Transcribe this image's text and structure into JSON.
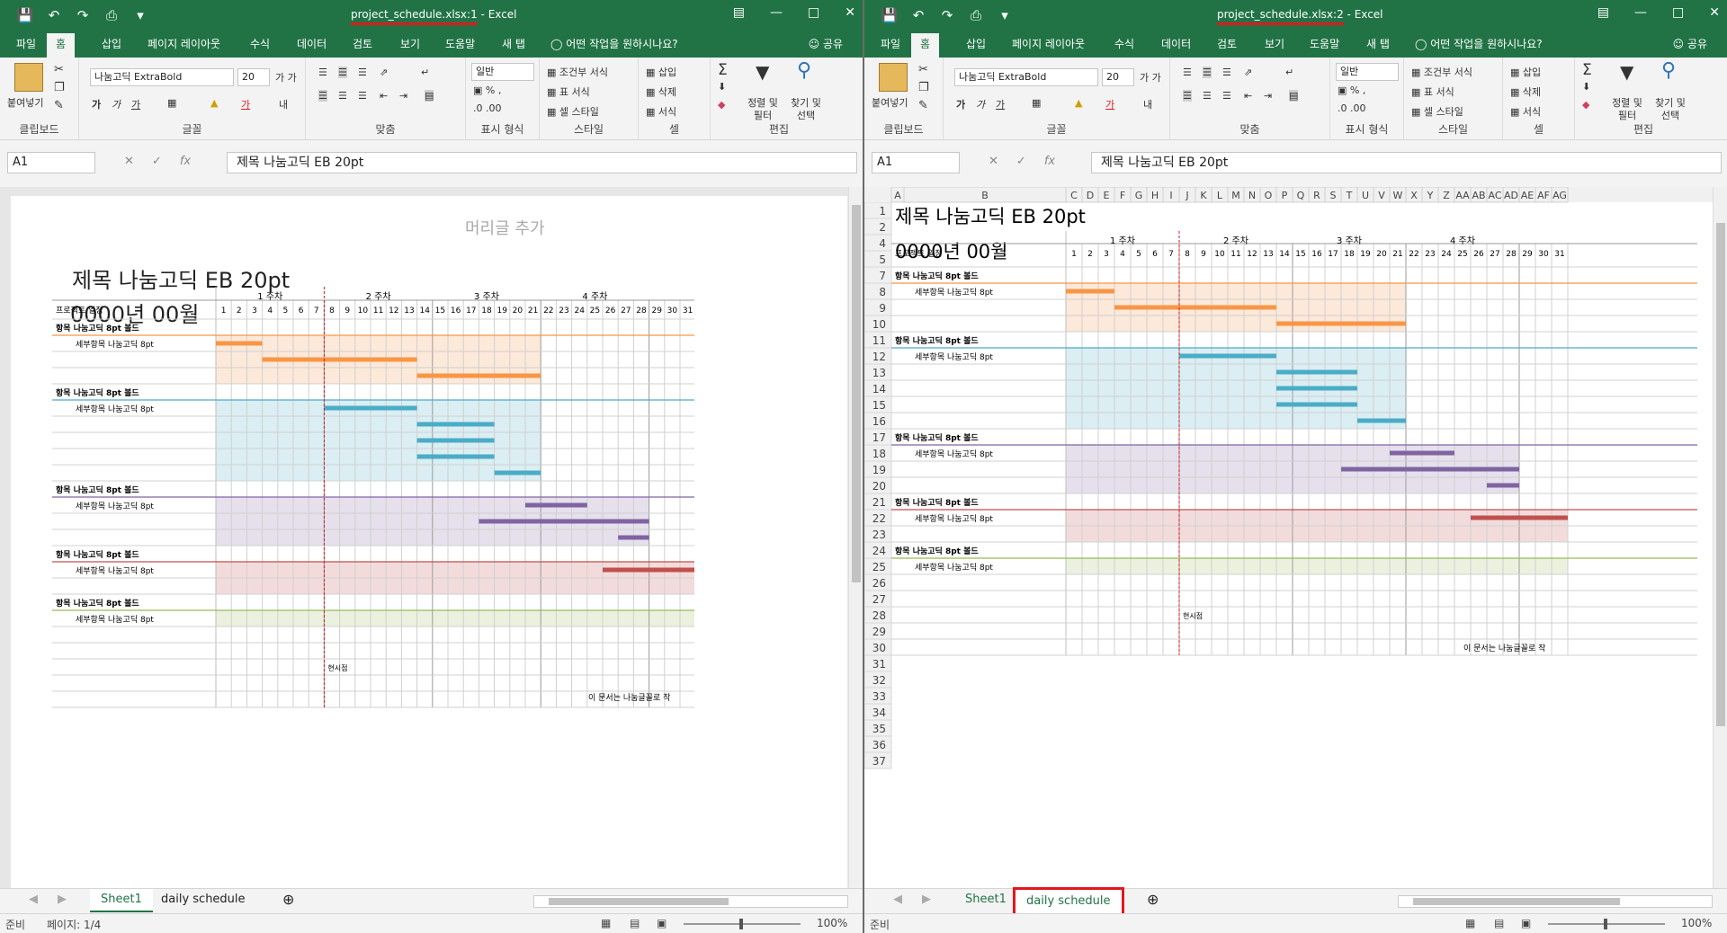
{
  "colors": {
    "excel_green": "#217346",
    "highlight_red": "#e0191e",
    "orange": "#f79646",
    "orange_band": "#fde9d9",
    "blue": "#4bacc6",
    "blue_band": "#daeef3",
    "purple": "#8064a2",
    "purple_band": "#e5e0ec",
    "red": "#c0504d",
    "red_band": "#f2dcdb",
    "green_band": "#ebf1de",
    "green_line": "#9bbb59"
  },
  "left": {
    "title_file": "project_schedule.xlsx:1",
    "title_sep": "-",
    "title_app": "Excel",
    "sheet_tabs": [
      "Sheet1",
      "daily schedule"
    ],
    "status_ready": "준비",
    "status_page": "페이지: 1/4",
    "zoom": "100%"
  },
  "right": {
    "title_file": "project_schedule.xlsx:2",
    "title_sep": "-",
    "title_app": "Excel",
    "sheet_tabs": [
      "Sheet1",
      "daily schedule"
    ],
    "status_ready": "준비",
    "zoom": "100%"
  },
  "ribbon_tabs": [
    "파일",
    "홈",
    "삽입",
    "페이지 레이아웃",
    "수식",
    "데이터",
    "검토",
    "보기",
    "도움말",
    "새 탭"
  ],
  "tell_me": "어떤 작업을 원하시나요?",
  "share": "공유",
  "ribbon": {
    "paste": "붙여넣기",
    "font_name": "나눔고딕 ExtraBold",
    "font_size": "20",
    "number_format": "일반",
    "cond_format": "조건부 서식",
    "table_format": "표 서식",
    "cell_style": "셀 스타일",
    "insert": "삽입",
    "delete": "삭제",
    "format": "서식",
    "sort_filter": "정렬 및 필터",
    "find_select": "찾기 및 선택",
    "groups": [
      "클립보드",
      "글꼴",
      "맞춤",
      "표시 형식",
      "스타일",
      "셀",
      "편집"
    ]
  },
  "name_box": "A1",
  "formula": "제목 나눔고딕 EB 20pt",
  "doc": {
    "header_placeholder": "머리글 추가",
    "title": "제목 나눔고딕 EB 20pt",
    "subtitle": "0000년 00월",
    "schedule_label": "프로젝트 일정",
    "weeks": [
      "1 주차",
      "2 주차",
      "3 주차",
      "4 주차"
    ],
    "days": [
      "1",
      "2",
      "3",
      "4",
      "5",
      "6",
      "7",
      "8",
      "9",
      "10",
      "11",
      "12",
      "13",
      "14",
      "15",
      "16",
      "17",
      "18",
      "19",
      "20",
      "21",
      "22",
      "23",
      "24",
      "25",
      "26",
      "27",
      "28",
      "29",
      "30",
      "31"
    ],
    "section": "항목 나눔고딕 8pt 볼드",
    "sub": "세부항목 나눔고딕 8pt",
    "today": "현시점",
    "footer": "이 문서는 나눔글꼴로 작"
  },
  "right_cols": [
    "A",
    "B",
    "C",
    "D",
    "E",
    "F",
    "G",
    "H",
    "I",
    "J",
    "K",
    "L",
    "M",
    "N",
    "O",
    "P",
    "Q",
    "R",
    "S",
    "T",
    "U",
    "V",
    "W",
    "X",
    "Y",
    "Z",
    "AA",
    "AB",
    "AC",
    "AD",
    "AE",
    "AF",
    "AG"
  ],
  "right_rows": [
    "1",
    "2",
    "4",
    "5",
    "7",
    "8",
    "9",
    "10",
    "11",
    "12",
    "13",
    "14",
    "15",
    "16",
    "17",
    "18",
    "19",
    "20",
    "21",
    "22",
    "23",
    "24",
    "25",
    "26",
    "27",
    "28",
    "29",
    "30",
    "31",
    "32",
    "33",
    "34",
    "35",
    "36",
    "37"
  ]
}
